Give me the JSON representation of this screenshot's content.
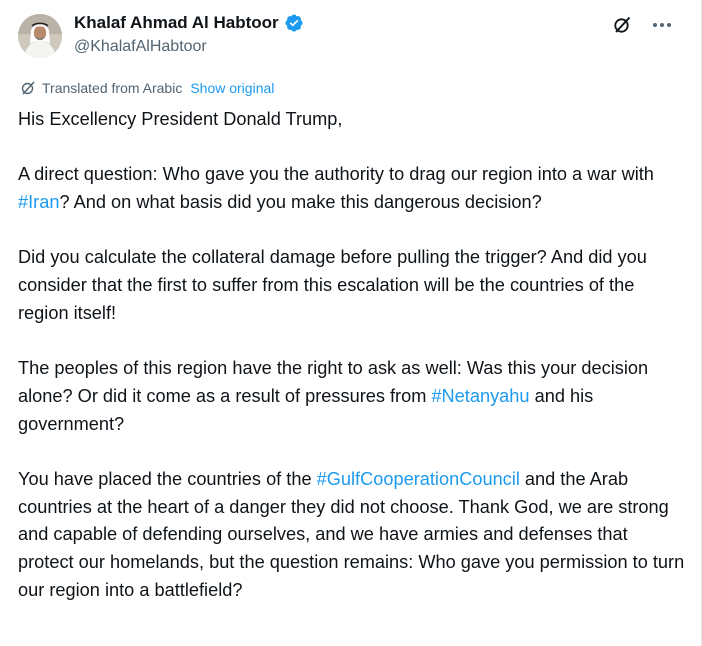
{
  "author": {
    "name": "Khalaf Ahmad Al Habtoor",
    "handle": "@KhalafAlHabtoor"
  },
  "icons": {
    "verified": "verified-badge-icon",
    "grok": "grok-icon",
    "more": "more-options-icon",
    "translate": "translate-icon"
  },
  "colors": {
    "link": "#1d9bf0",
    "text": "#0f1419",
    "secondary": "#536471"
  },
  "translation": {
    "label": "Translated from Arabic",
    "show_original": "Show original"
  },
  "post": {
    "p1": "His Excellency President Donald Trump,",
    "p2_a": "A direct question: Who gave you the authority to drag our region into a war with ",
    "p2_tag": "#Iran",
    "p2_b": "? And on what basis did you make this dangerous decision?",
    "p3": "Did you calculate the collateral damage before pulling the trigger? And did you consider that the first to suffer from this escalation will be the countries of the region itself!",
    "p4_a": "The peoples of this region have the right to ask as well: Was this your decision alone? Or did it come as a result of pressures from ",
    "p4_tag": "#Netanyahu",
    "p4_b": " and his government?",
    "p5_a": "You have placed the countries of the ",
    "p5_tag": "#GulfCooperationCouncil",
    "p5_b": " and the Arab countries at the heart of a danger they did not choose. Thank God, we are strong and capable of defending ourselves, and we have armies and defenses that protect our homelands, but the question remains: Who gave you permission to turn our region into a battlefield?"
  }
}
